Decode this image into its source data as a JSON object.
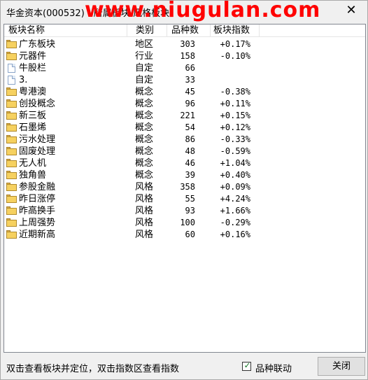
{
  "window": {
    "title": "华金资本(000532) - 所属板块/风格板块",
    "close_glyph": "✕"
  },
  "watermark": "www.niugulan.com",
  "table": {
    "columns": [
      "板块名称",
      "类别",
      "品种数",
      "板块指数"
    ],
    "rows": [
      {
        "icon": "folder-icon",
        "name": "广东板块",
        "type": "地区",
        "count": "303",
        "index": "+0.17%"
      },
      {
        "icon": "folder-icon",
        "name": "元器件",
        "type": "行业",
        "count": "158",
        "index": "-0.10%"
      },
      {
        "icon": "document-icon",
        "name": "牛股栏",
        "type": "自定",
        "count": "66",
        "index": ""
      },
      {
        "icon": "document-icon",
        "name": "3.",
        "type": "自定",
        "count": "33",
        "index": ""
      },
      {
        "icon": "folder-icon",
        "name": "粤港澳",
        "type": "概念",
        "count": "45",
        "index": "-0.38%"
      },
      {
        "icon": "folder-icon",
        "name": "创投概念",
        "type": "概念",
        "count": "96",
        "index": "+0.11%"
      },
      {
        "icon": "folder-icon",
        "name": "新三板",
        "type": "概念",
        "count": "221",
        "index": "+0.15%"
      },
      {
        "icon": "folder-icon",
        "name": "石墨烯",
        "type": "概念",
        "count": "54",
        "index": "+0.12%"
      },
      {
        "icon": "folder-icon",
        "name": "污水处理",
        "type": "概念",
        "count": "86",
        "index": "-0.33%"
      },
      {
        "icon": "folder-icon",
        "name": "固废处理",
        "type": "概念",
        "count": "48",
        "index": "-0.59%"
      },
      {
        "icon": "folder-icon",
        "name": "无人机",
        "type": "概念",
        "count": "46",
        "index": "+1.04%"
      },
      {
        "icon": "folder-icon",
        "name": "独角兽",
        "type": "概念",
        "count": "39",
        "index": "+0.40%"
      },
      {
        "icon": "folder-icon",
        "name": "参股金融",
        "type": "风格",
        "count": "358",
        "index": "+0.09%"
      },
      {
        "icon": "folder-icon",
        "name": "昨日涨停",
        "type": "风格",
        "count": "55",
        "index": "+4.24%"
      },
      {
        "icon": "folder-icon",
        "name": "昨高换手",
        "type": "风格",
        "count": "93",
        "index": "+1.66%"
      },
      {
        "icon": "folder-icon",
        "name": "上周强势",
        "type": "风格",
        "count": "100",
        "index": "-0.29%"
      },
      {
        "icon": "folder-icon",
        "name": "近期新高",
        "type": "风格",
        "count": "60",
        "index": "+0.16%"
      }
    ]
  },
  "footer": {
    "hint": "双击查看板块并定位，双击指数区查看指数",
    "checkbox_label": "品种联动",
    "checkbox_checked": true,
    "close_label": "关闭"
  },
  "colors": {
    "watermark": "#ff0000",
    "folder": "#f6d160",
    "checkmark": "#1b7a2c"
  }
}
